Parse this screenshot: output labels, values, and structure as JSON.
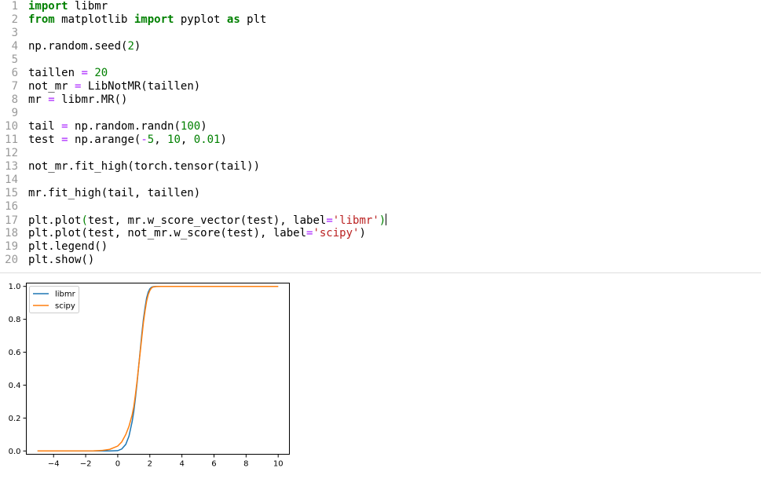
{
  "code": {
    "lines": [
      {
        "n": "1",
        "tokens": [
          {
            "t": "import",
            "c": "kw"
          },
          {
            "t": " libmr",
            "c": "txt"
          }
        ]
      },
      {
        "n": "2",
        "tokens": [
          {
            "t": "from",
            "c": "kw"
          },
          {
            "t": " matplotlib ",
            "c": "txt"
          },
          {
            "t": "import",
            "c": "kw"
          },
          {
            "t": " pyplot ",
            "c": "txt"
          },
          {
            "t": "as",
            "c": "kw"
          },
          {
            "t": " plt",
            "c": "txt"
          }
        ]
      },
      {
        "n": "3",
        "tokens": []
      },
      {
        "n": "4",
        "tokens": [
          {
            "t": "np.random.seed(",
            "c": "txt"
          },
          {
            "t": "2",
            "c": "num"
          },
          {
            "t": ")",
            "c": "txt"
          }
        ]
      },
      {
        "n": "5",
        "tokens": []
      },
      {
        "n": "6",
        "tokens": [
          {
            "t": "taillen ",
            "c": "txt"
          },
          {
            "t": "=",
            "c": "op"
          },
          {
            "t": " ",
            "c": "txt"
          },
          {
            "t": "20",
            "c": "num"
          }
        ]
      },
      {
        "n": "7",
        "tokens": [
          {
            "t": "not_mr ",
            "c": "txt"
          },
          {
            "t": "=",
            "c": "op"
          },
          {
            "t": " LibNotMR(taillen)",
            "c": "txt"
          }
        ]
      },
      {
        "n": "8",
        "tokens": [
          {
            "t": "mr ",
            "c": "txt"
          },
          {
            "t": "=",
            "c": "op"
          },
          {
            "t": " libmr.MR()",
            "c": "txt"
          }
        ]
      },
      {
        "n": "9",
        "tokens": []
      },
      {
        "n": "10",
        "tokens": [
          {
            "t": "tail ",
            "c": "txt"
          },
          {
            "t": "=",
            "c": "op"
          },
          {
            "t": " np.random.randn(",
            "c": "txt"
          },
          {
            "t": "100",
            "c": "num"
          },
          {
            "t": ")",
            "c": "txt"
          }
        ]
      },
      {
        "n": "11",
        "tokens": [
          {
            "t": "test ",
            "c": "txt"
          },
          {
            "t": "=",
            "c": "op"
          },
          {
            "t": " np.arange(",
            "c": "txt"
          },
          {
            "t": "-",
            "c": "op"
          },
          {
            "t": "5",
            "c": "num"
          },
          {
            "t": ", ",
            "c": "txt"
          },
          {
            "t": "10",
            "c": "num"
          },
          {
            "t": ", ",
            "c": "txt"
          },
          {
            "t": "0.01",
            "c": "num"
          },
          {
            "t": ")",
            "c": "txt"
          }
        ]
      },
      {
        "n": "12",
        "tokens": []
      },
      {
        "n": "13",
        "tokens": [
          {
            "t": "not_mr.fit_high(torch.tensor(tail))",
            "c": "txt"
          }
        ]
      },
      {
        "n": "14",
        "tokens": []
      },
      {
        "n": "15",
        "tokens": [
          {
            "t": "mr.fit_high(tail, taillen)",
            "c": "txt"
          }
        ]
      },
      {
        "n": "16",
        "tokens": []
      },
      {
        "n": "17",
        "tokens": [
          {
            "t": "plt.plot",
            "c": "txt"
          },
          {
            "t": "(",
            "c": "num"
          },
          {
            "t": "test, mr.w_score_vector(test), label",
            "c": "txt"
          },
          {
            "t": "=",
            "c": "op"
          },
          {
            "t": "'libmr'",
            "c": "str"
          },
          {
            "t": ")",
            "c": "num"
          }
        ],
        "cursor": true
      },
      {
        "n": "18",
        "tokens": [
          {
            "t": "plt.plot(test, not_mr.w_score(test), label",
            "c": "txt"
          },
          {
            "t": "=",
            "c": "op"
          },
          {
            "t": "'scipy'",
            "c": "str"
          },
          {
            "t": ")",
            "c": "txt"
          }
        ]
      },
      {
        "n": "19",
        "tokens": [
          {
            "t": "plt.legend()",
            "c": "txt"
          }
        ]
      },
      {
        "n": "20",
        "tokens": [
          {
            "t": "plt.show()",
            "c": "txt"
          }
        ]
      }
    ]
  },
  "chart_data": {
    "type": "line",
    "title": "",
    "xlabel": "",
    "ylabel": "",
    "xlim": [
      -5.7,
      10.7
    ],
    "ylim": [
      -0.02,
      1.02
    ],
    "xticks": [
      -4,
      -2,
      0,
      2,
      4,
      6,
      8,
      10
    ],
    "xtick_labels": [
      "−4",
      "−2",
      "0",
      "2",
      "4",
      "6",
      "8",
      "10"
    ],
    "yticks": [
      0.0,
      0.2,
      0.4,
      0.6,
      0.8,
      1.0
    ],
    "ytick_labels": [
      "0.0",
      "0.2",
      "0.4",
      "0.6",
      "0.8",
      "1.0"
    ],
    "grid": false,
    "legend_position": "top-left",
    "series": [
      {
        "name": "libmr",
        "color": "#1f77b4",
        "x": [
          -5,
          -1,
          -0.5,
          0,
          0.25,
          0.5,
          0.7,
          0.9,
          1.0,
          1.1,
          1.2,
          1.3,
          1.4,
          1.5,
          1.6,
          1.7,
          1.8,
          1.9,
          2.0,
          2.1,
          2.2,
          2.4,
          2.7,
          3,
          10
        ],
        "y": [
          0,
          0,
          0,
          0.002,
          0.012,
          0.04,
          0.09,
          0.18,
          0.24,
          0.32,
          0.41,
          0.51,
          0.61,
          0.71,
          0.8,
          0.87,
          0.93,
          0.965,
          0.985,
          0.994,
          0.998,
          1.0,
          1.0,
          1.0,
          1.0
        ]
      },
      {
        "name": "scipy",
        "color": "#ff7f0e",
        "x": [
          -5,
          -1.5,
          -1,
          -0.5,
          0,
          0.25,
          0.5,
          0.7,
          0.9,
          1.0,
          1.1,
          1.2,
          1.3,
          1.4,
          1.5,
          1.6,
          1.7,
          1.8,
          1.9,
          2.0,
          2.1,
          2.2,
          2.4,
          2.7,
          3,
          10
        ],
        "y": [
          0,
          0.001,
          0.003,
          0.01,
          0.03,
          0.055,
          0.1,
          0.15,
          0.22,
          0.27,
          0.34,
          0.42,
          0.51,
          0.6,
          0.69,
          0.78,
          0.85,
          0.91,
          0.95,
          0.975,
          0.99,
          0.996,
          0.999,
          1.0,
          1.0,
          1.0
        ]
      }
    ]
  }
}
